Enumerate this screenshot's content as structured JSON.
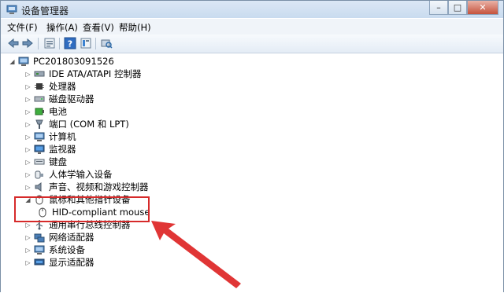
{
  "window": {
    "title": "设备管理器",
    "min": "–",
    "max": "□",
    "close": "✕"
  },
  "menu": [
    {
      "label": "文件(F)"
    },
    {
      "label": "操作(A)"
    },
    {
      "label": "查看(V)"
    },
    {
      "label": "帮助(H)"
    }
  ],
  "toolbar": {
    "icons": [
      "back-arrow-icon",
      "forward-arrow-icon",
      "properties-icon",
      "help-icon",
      "details-icon",
      "scan-hardware-icon"
    ]
  },
  "tree": {
    "root": "PC201803091526",
    "items": [
      {
        "label": "IDE ATA/ATAPI 控制器",
        "icon": "ide-controller-icon",
        "expanded": false
      },
      {
        "label": "处理器",
        "icon": "processor-icon",
        "expanded": false
      },
      {
        "label": "磁盘驱动器",
        "icon": "disk-drive-icon",
        "expanded": false
      },
      {
        "label": "电池",
        "icon": "battery-icon",
        "expanded": false
      },
      {
        "label": "端口 (COM 和 LPT)",
        "icon": "port-icon",
        "expanded": false
      },
      {
        "label": "计算机",
        "icon": "computer-icon",
        "expanded": false
      },
      {
        "label": "监视器",
        "icon": "monitor-icon",
        "expanded": false
      },
      {
        "label": "键盘",
        "icon": "keyboard-icon",
        "expanded": false
      },
      {
        "label": "人体学输入设备",
        "icon": "hid-icon",
        "expanded": false
      },
      {
        "label": "声音、视频和游戏控制器",
        "icon": "sound-icon",
        "expanded": false
      },
      {
        "label": "鼠标和其他指针设备",
        "icon": "mouse-icon",
        "expanded": true
      },
      {
        "label": "HID-compliant mouse",
        "icon": "mouse-icon",
        "child": true
      },
      {
        "label": "通用串行总线控制器",
        "icon": "usb-icon",
        "expanded": false
      },
      {
        "label": "网络适配器",
        "icon": "network-adapter-icon",
        "expanded": false
      },
      {
        "label": "系统设备",
        "icon": "system-device-icon",
        "expanded": false
      },
      {
        "label": "显示适配器",
        "icon": "display-adapter-icon",
        "expanded": false
      }
    ]
  },
  "colors": {
    "highlight_box": "#d62a2a",
    "arrow": "#e03535"
  }
}
